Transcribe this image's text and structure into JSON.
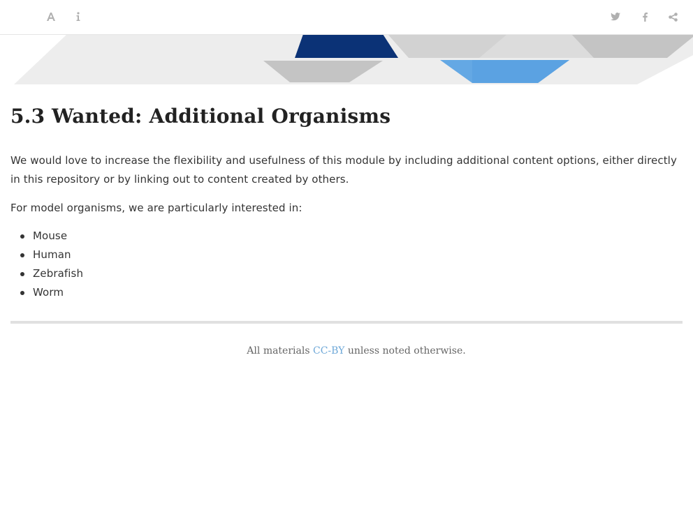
{
  "toolbar": {
    "left_icons": [
      "font-settings-icon",
      "info-icon"
    ],
    "right_icons": [
      "twitter-icon",
      "facebook-icon",
      "share-icon"
    ]
  },
  "banner": {
    "colors": {
      "navy": "#0b3276",
      "light_blue": "#64a8e4",
      "gray": "#c4c4c4",
      "light_gray": "#e8e8e8"
    }
  },
  "section": {
    "number": "5.3",
    "title": "Wanted: Additional Organisms",
    "paragraph1": "We would love to increase the flexibility and usefulness of this module by including additional content options, either directly in this repository or by linking out to content created by others.",
    "paragraph2": "For model organisms, we are particularly interested in:",
    "organisms": [
      "Mouse",
      "Human",
      "Zebrafish",
      "Worm"
    ]
  },
  "footer": {
    "prefix": "All materials ",
    "link_text": "CC-BY",
    "suffix": " unless noted otherwise.",
    "link_color": "#6ea8d8"
  }
}
